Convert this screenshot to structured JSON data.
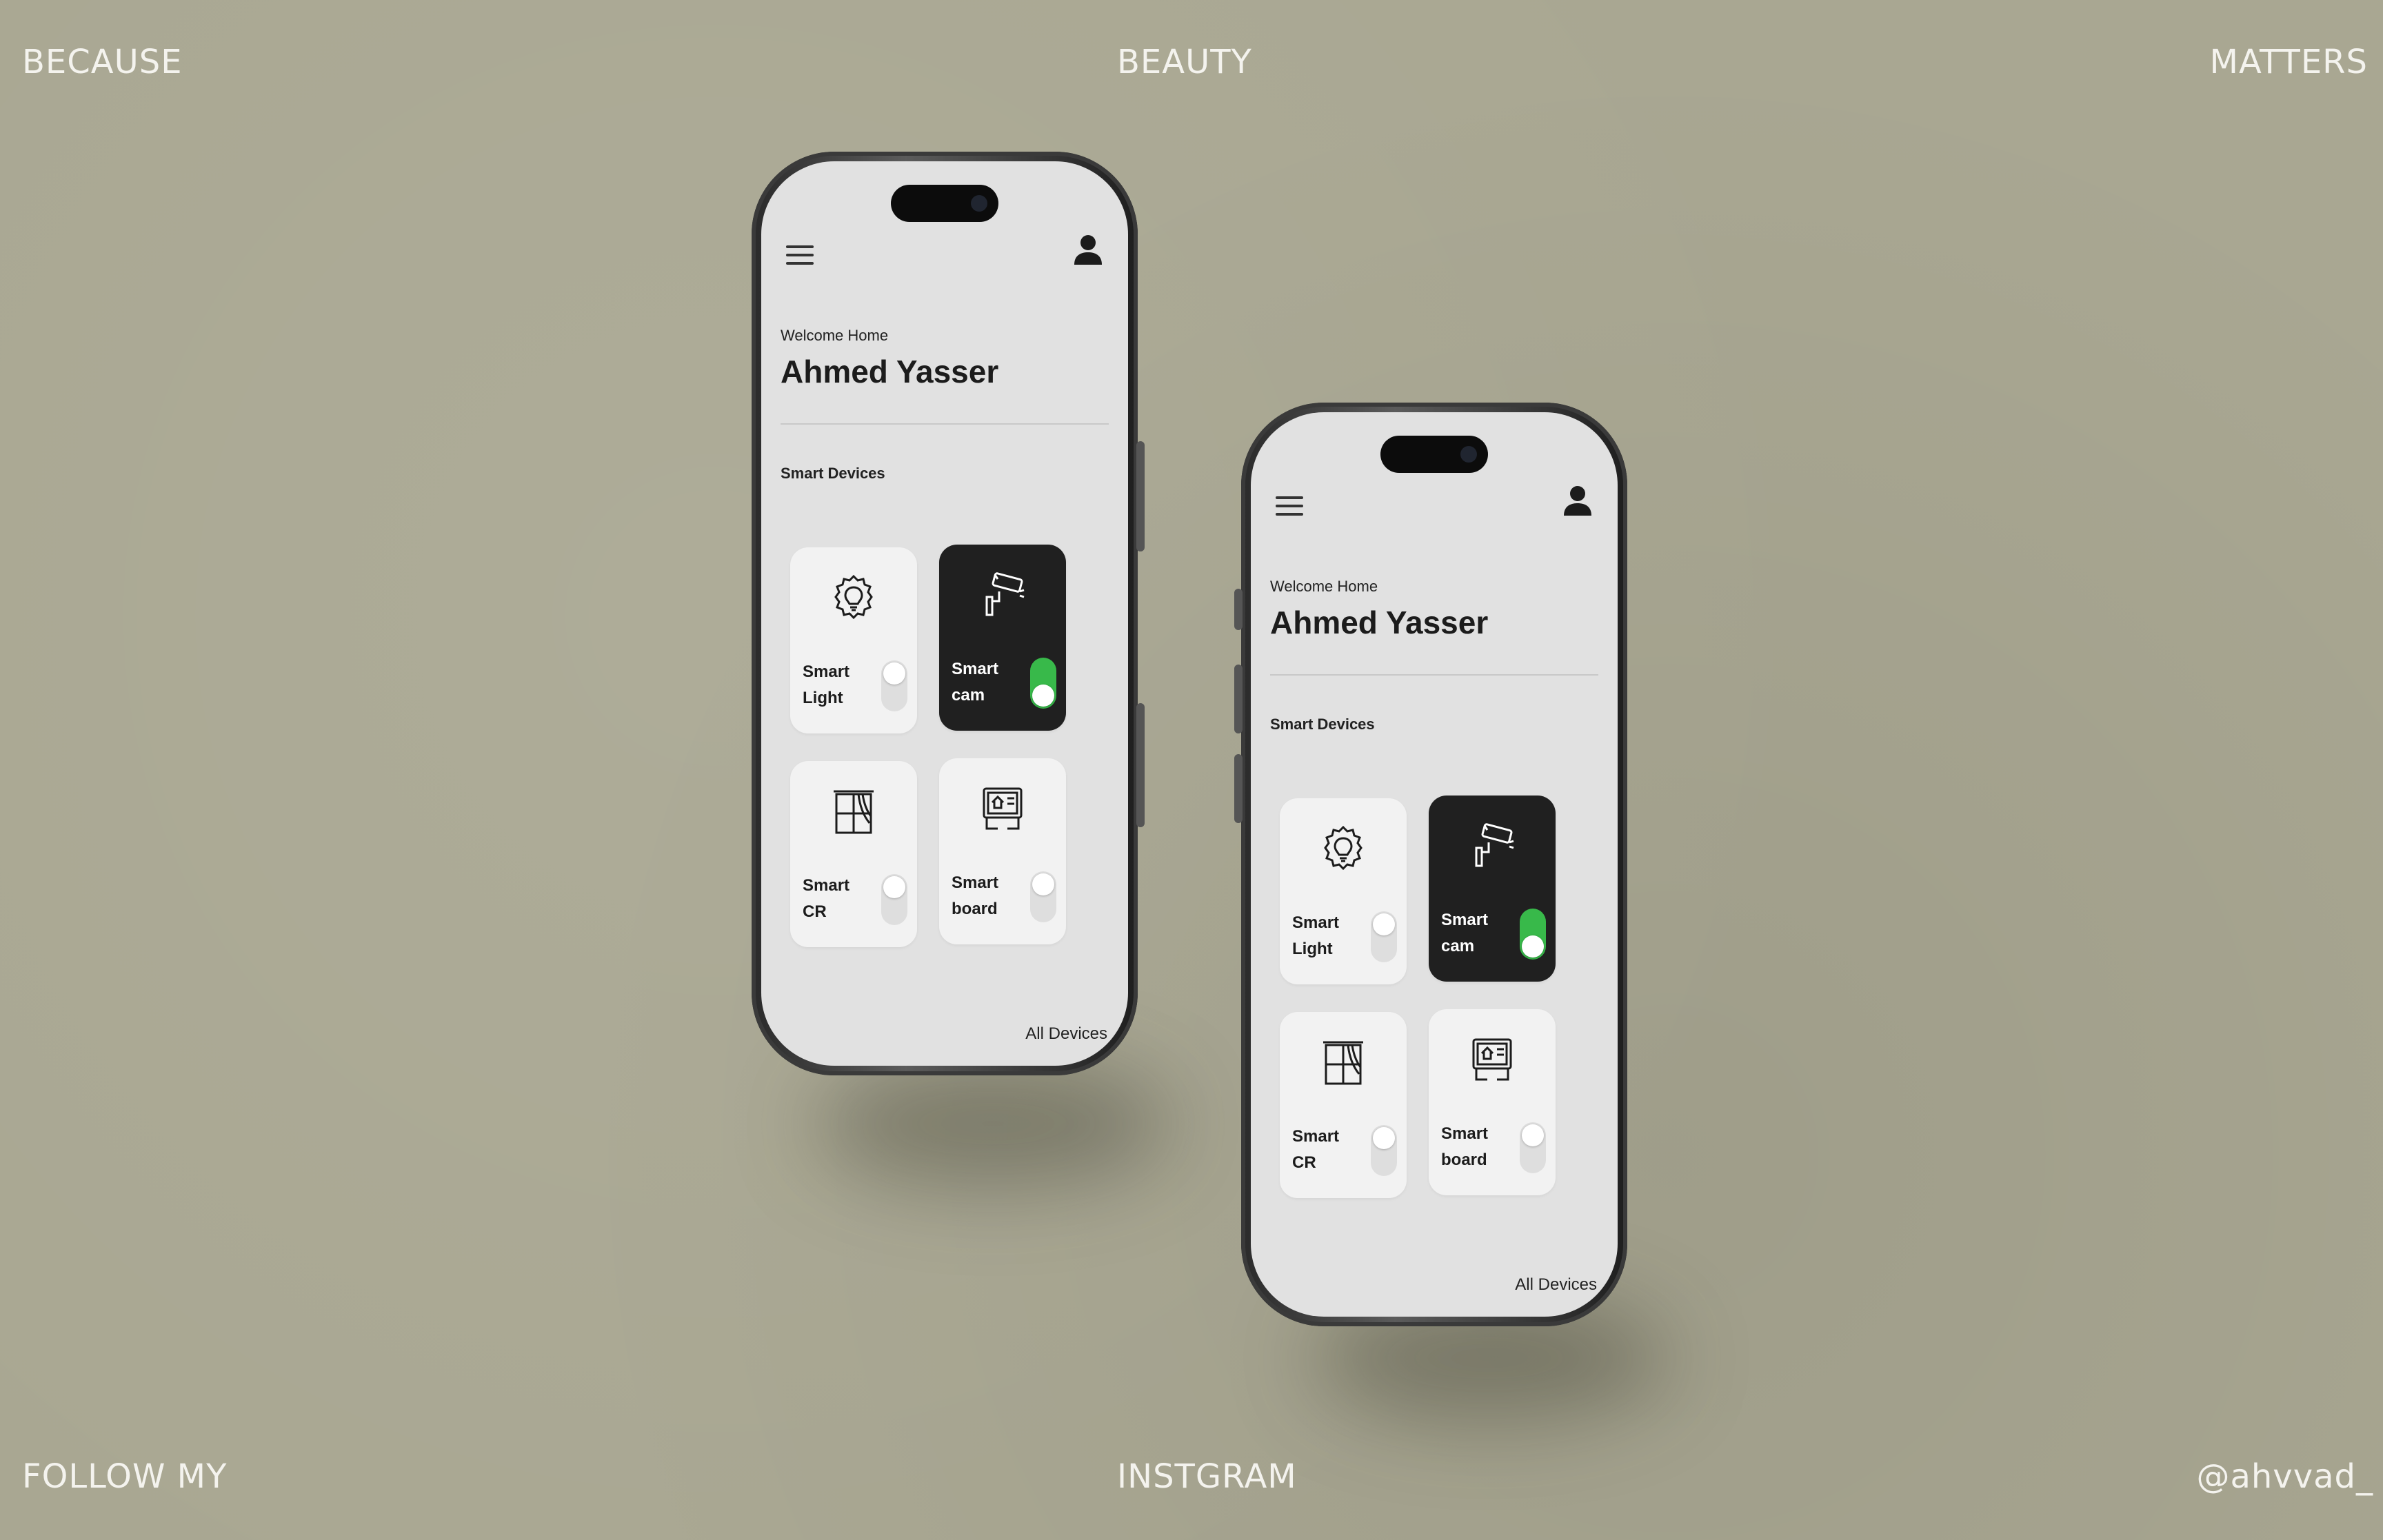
{
  "corners": {
    "top_left": "BECAUSE",
    "top_center": "BEAUTY",
    "top_right": "MATTERS",
    "bottom_left": "FOLLOW MY",
    "bottom_center": "INSTGRAM",
    "bottom_right": "@ahvvad_"
  },
  "app": {
    "welcome": "Welcome Home",
    "user_name": "Ahmed Yasser",
    "section_title": "Smart Devices",
    "all_devices": "All Devices",
    "devices": [
      {
        "line1": "Smart",
        "line2": "Light",
        "icon": "light-bulb-icon",
        "on": false
      },
      {
        "line1": "Smart",
        "line2": "cam",
        "icon": "security-camera-icon",
        "on": true
      },
      {
        "line1": "Smart",
        "line2": "CR",
        "icon": "curtain-icon",
        "on": false
      },
      {
        "line1": "Smart",
        "line2": "board",
        "icon": "control-board-icon",
        "on": false
      }
    ]
  },
  "colors": {
    "background": "#a9a792",
    "screen": "#e1e1e1",
    "active_card": "#202020",
    "toggle_on": "#38b94a"
  }
}
